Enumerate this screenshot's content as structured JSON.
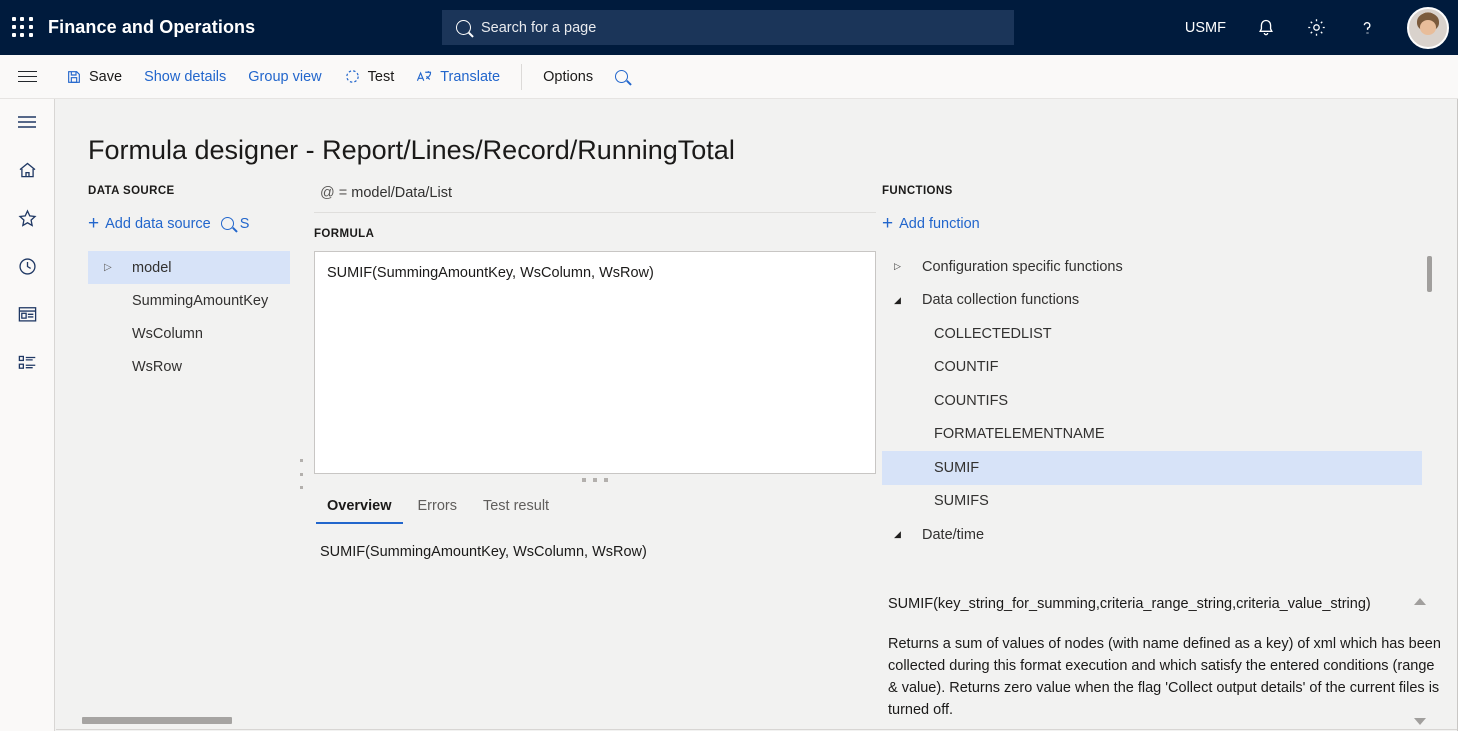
{
  "topbar": {
    "waffle_icon": "waffle-grid-icon",
    "app_title": "Finance and Operations",
    "search_placeholder": "Search for a page",
    "company": "USMF",
    "icons": [
      "notifications-bell-icon",
      "settings-gear-icon",
      "help-question-icon"
    ],
    "avatar": "user-avatar"
  },
  "commandbar": {
    "menu_icon": "hamburger-menu-icon",
    "items": [
      {
        "label": "Save",
        "icon": "save-disk-icon",
        "style": "dark"
      },
      {
        "label": "Show details",
        "icon": "",
        "style": "link"
      },
      {
        "label": "Group view",
        "icon": "",
        "style": "link"
      },
      {
        "label": "Test",
        "icon": "test-refresh-icon",
        "style": "dark"
      },
      {
        "label": "Translate",
        "icon": "translate-icon",
        "style": "link"
      },
      {
        "label": "Options",
        "icon": "",
        "style": "dark"
      }
    ],
    "search_icon": "search-icon",
    "right_icons": [
      "diamond-share-icon",
      "office-app-icon",
      "refresh-circle-icon",
      "open-in-new-window-icon",
      "close-icon"
    ]
  },
  "rail": {
    "items": [
      {
        "name": "navigation-menu",
        "icon": "hamburger-menu-icon"
      },
      {
        "name": "home",
        "icon": "home-icon"
      },
      {
        "name": "favorites",
        "icon": "star-icon"
      },
      {
        "name": "recent",
        "icon": "clock-icon"
      },
      {
        "name": "workspaces",
        "icon": "workspace-icon"
      },
      {
        "name": "modules",
        "icon": "list-modules-icon"
      }
    ]
  },
  "page": {
    "title": "Formula designer - Report/Lines/Record/RunningTotal"
  },
  "data_source": {
    "heading": "DATA SOURCE",
    "add_label": "Add data source",
    "search_label": "S",
    "tree": [
      {
        "label": "model",
        "type": "parent",
        "selected": true,
        "caret": "▷"
      },
      {
        "label": "SummingAmountKey",
        "type": "child",
        "selected": false
      },
      {
        "label": "WsColumn",
        "type": "child",
        "selected": false
      },
      {
        "label": "WsRow",
        "type": "child",
        "selected": false
      }
    ]
  },
  "formula": {
    "binding_prefix": "@ = ",
    "binding_path": "model/Data/List",
    "heading": "FORMULA",
    "value": "SUMIF(SummingAmountKey, WsColumn, WsRow)",
    "tabs": [
      {
        "label": "Overview",
        "active": true
      },
      {
        "label": "Errors",
        "active": false
      },
      {
        "label": "Test result",
        "active": false
      }
    ],
    "overview_text": "SUMIF(SummingAmountKey, WsColumn, WsRow)"
  },
  "functions": {
    "heading": "FUNCTIONS",
    "add_label": "Add function",
    "tree": [
      {
        "label": "Configuration specific functions",
        "type": "group",
        "expanded": false,
        "caret": "▷",
        "selected": false
      },
      {
        "label": "Data collection functions",
        "type": "group",
        "expanded": true,
        "caret": "◢",
        "selected": false
      },
      {
        "label": "COLLECTEDLIST",
        "type": "leaf",
        "selected": false
      },
      {
        "label": "COUNTIF",
        "type": "leaf",
        "selected": false
      },
      {
        "label": "COUNTIFS",
        "type": "leaf",
        "selected": false
      },
      {
        "label": "FORMATELEMENTNAME",
        "type": "leaf",
        "selected": false
      },
      {
        "label": "SUMIF",
        "type": "leaf",
        "selected": true
      },
      {
        "label": "SUMIFS",
        "type": "leaf",
        "selected": false
      },
      {
        "label": "Date/time",
        "type": "group",
        "expanded": true,
        "caret": "◢",
        "selected": false
      }
    ],
    "signature": "SUMIF(key_string_for_summing,criteria_range_string,criteria_value_string)",
    "description": "Returns a sum of values of nodes (with name defined as a key) of xml which has been collected during this format execution and which satisfy the entered conditions (range & value). Returns zero value when the flag 'Collect output details' of the current files is turned off."
  },
  "colors": {
    "brand_navy": "#001b3d",
    "link_blue": "#2266cc",
    "selection_blue": "#d7e3f8",
    "canvas": "#f2f2f1",
    "chrome": "#faf9f8"
  }
}
